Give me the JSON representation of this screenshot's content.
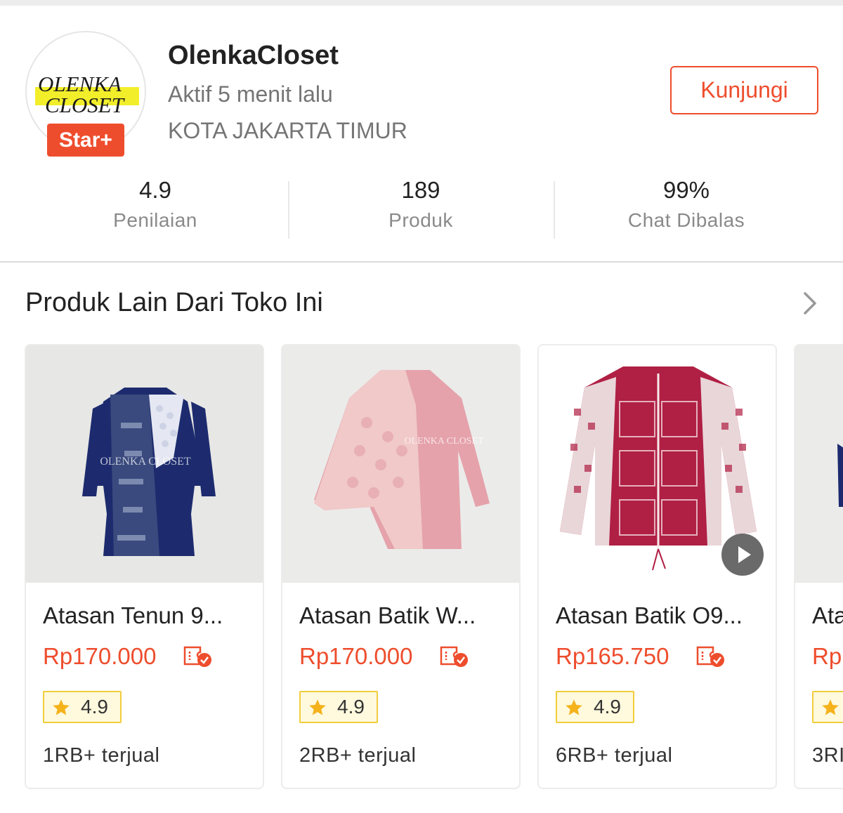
{
  "shop": {
    "logo_line1": "OLENKA",
    "logo_line2": "CLOSET",
    "badge": "Star+",
    "name": "OlenkaCloset",
    "active": "Aktif 5 menit lalu",
    "location": "KOTA JAKARTA TIMUR",
    "visit_label": "Kunjungi"
  },
  "stats": [
    {
      "value": "4.9",
      "label": "Penilaian"
    },
    {
      "value": "189",
      "label": "Produk"
    },
    {
      "value": "99%",
      "label": "Chat Dibalas"
    }
  ],
  "section": {
    "title": "Produk Lain Dari Toko Ini",
    "more_icon": "chevron-right-icon"
  },
  "products": [
    {
      "title": "Atasan Tenun 9...",
      "price": "Rp170.000",
      "rating": "4.9",
      "sold": "1RB+ terjual",
      "has_video": false,
      "watermark": "OLENKA CLOSET"
    },
    {
      "title": "Atasan Batik W...",
      "price": "Rp170.000",
      "rating": "4.9",
      "sold": "2RB+ terjual",
      "has_video": false,
      "watermark": "OLENKA CLOSET"
    },
    {
      "title": "Atasan Batik O9...",
      "price": "Rp165.750",
      "rating": "4.9",
      "sold": "6RB+ terjual",
      "has_video": true
    },
    {
      "title": "Ata",
      "price": "Rp",
      "rating": "",
      "sold": "3RI"
    }
  ],
  "colors": {
    "accent": "#ee4d2d",
    "rating_border": "#f2cd3c",
    "rating_bg": "#fff9dd",
    "muted_text": "#757575"
  }
}
